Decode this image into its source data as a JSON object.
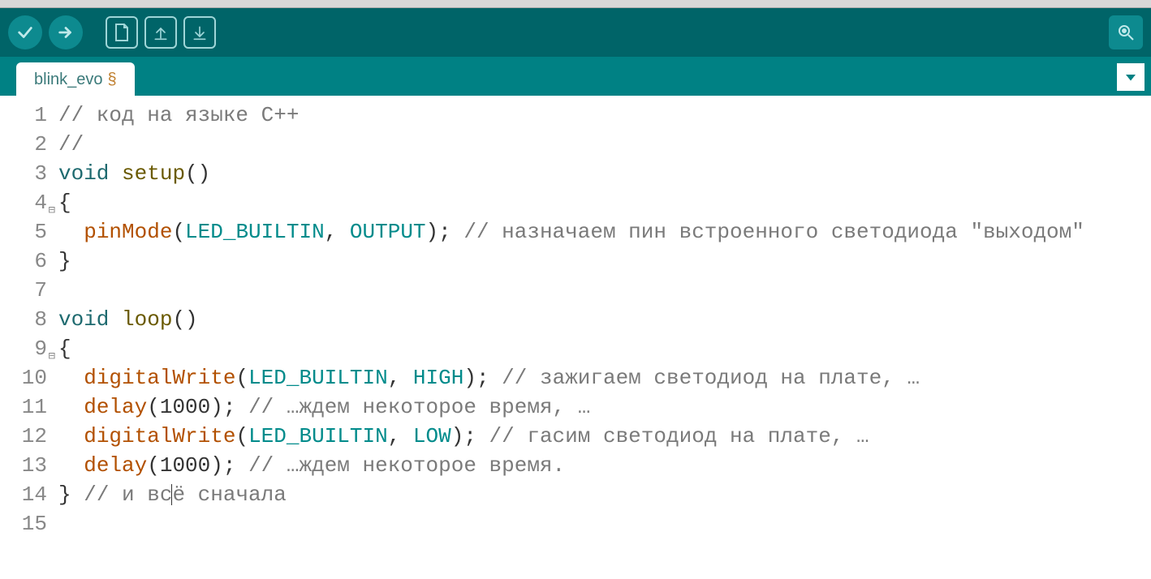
{
  "tab": {
    "name": "blink_evo",
    "modified_marker": "§"
  },
  "icons": {
    "verify": "verify-icon",
    "upload": "upload-icon",
    "new": "new-icon",
    "open": "open-icon",
    "save": "save-icon",
    "serial": "serial-monitor-icon",
    "dropdown": "dropdown-icon"
  },
  "code": {
    "lines": [
      {
        "n": 1,
        "fold": "",
        "tokens": [
          {
            "t": "// код на языке C++",
            "c": "comment"
          }
        ]
      },
      {
        "n": 2,
        "fold": "",
        "tokens": [
          {
            "t": "//",
            "c": "comment"
          }
        ]
      },
      {
        "n": 3,
        "fold": "",
        "tokens": [
          {
            "t": "void",
            "c": "keyword"
          },
          {
            "t": " ",
            "c": "plain"
          },
          {
            "t": "setup",
            "c": "func"
          },
          {
            "t": "()",
            "c": "plain"
          }
        ]
      },
      {
        "n": 4,
        "fold": "⊟",
        "tokens": [
          {
            "t": "{",
            "c": "plain"
          }
        ]
      },
      {
        "n": 5,
        "fold": "",
        "tokens": [
          {
            "t": "  ",
            "c": "plain"
          },
          {
            "t": "pinMode",
            "c": "userfn"
          },
          {
            "t": "(",
            "c": "plain"
          },
          {
            "t": "LED_BUILTIN",
            "c": "const"
          },
          {
            "t": ", ",
            "c": "plain"
          },
          {
            "t": "OUTPUT",
            "c": "const"
          },
          {
            "t": "); ",
            "c": "plain"
          },
          {
            "t": "// назначаем пин встроенного светодиода \"выходом\"",
            "c": "comment"
          }
        ]
      },
      {
        "n": 6,
        "fold": "",
        "tokens": [
          {
            "t": "}",
            "c": "plain"
          }
        ]
      },
      {
        "n": 7,
        "fold": "",
        "tokens": [
          {
            "t": "",
            "c": "plain"
          }
        ]
      },
      {
        "n": 8,
        "fold": "",
        "tokens": [
          {
            "t": "void",
            "c": "keyword"
          },
          {
            "t": " ",
            "c": "plain"
          },
          {
            "t": "loop",
            "c": "func"
          },
          {
            "t": "()",
            "c": "plain"
          }
        ]
      },
      {
        "n": 9,
        "fold": "⊟",
        "tokens": [
          {
            "t": "{",
            "c": "plain"
          }
        ]
      },
      {
        "n": 10,
        "fold": "",
        "tokens": [
          {
            "t": "  ",
            "c": "plain"
          },
          {
            "t": "digitalWrite",
            "c": "userfn"
          },
          {
            "t": "(",
            "c": "plain"
          },
          {
            "t": "LED_BUILTIN",
            "c": "const"
          },
          {
            "t": ", ",
            "c": "plain"
          },
          {
            "t": "HIGH",
            "c": "const"
          },
          {
            "t": "); ",
            "c": "plain"
          },
          {
            "t": "// зажигаем светодиод на плате, …",
            "c": "comment"
          }
        ]
      },
      {
        "n": 11,
        "fold": "",
        "tokens": [
          {
            "t": "  ",
            "c": "plain"
          },
          {
            "t": "delay",
            "c": "userfn"
          },
          {
            "t": "(",
            "c": "plain"
          },
          {
            "t": "1000",
            "c": "num"
          },
          {
            "t": "); ",
            "c": "plain"
          },
          {
            "t": "// …ждем некоторое время, …",
            "c": "comment"
          }
        ]
      },
      {
        "n": 12,
        "fold": "",
        "tokens": [
          {
            "t": "  ",
            "c": "plain"
          },
          {
            "t": "digitalWrite",
            "c": "userfn"
          },
          {
            "t": "(",
            "c": "plain"
          },
          {
            "t": "LED_BUILTIN",
            "c": "const"
          },
          {
            "t": ", ",
            "c": "plain"
          },
          {
            "t": "LOW",
            "c": "const"
          },
          {
            "t": "); ",
            "c": "plain"
          },
          {
            "t": "// гасим светодиод на плате, …",
            "c": "comment"
          }
        ]
      },
      {
        "n": 13,
        "fold": "",
        "tokens": [
          {
            "t": "  ",
            "c": "plain"
          },
          {
            "t": "delay",
            "c": "userfn"
          },
          {
            "t": "(",
            "c": "plain"
          },
          {
            "t": "1000",
            "c": "num"
          },
          {
            "t": "); ",
            "c": "plain"
          },
          {
            "t": "// …ждем некоторое время.",
            "c": "comment"
          }
        ]
      },
      {
        "n": 14,
        "fold": "",
        "tokens": [
          {
            "t": "} ",
            "c": "plain"
          },
          {
            "t": "// и вс",
            "c": "comment"
          },
          {
            "cursor": true
          },
          {
            "t": "ё сначала",
            "c": "comment"
          }
        ]
      },
      {
        "n": 15,
        "fold": "",
        "tokens": [
          {
            "t": "",
            "c": "plain"
          }
        ]
      }
    ]
  }
}
